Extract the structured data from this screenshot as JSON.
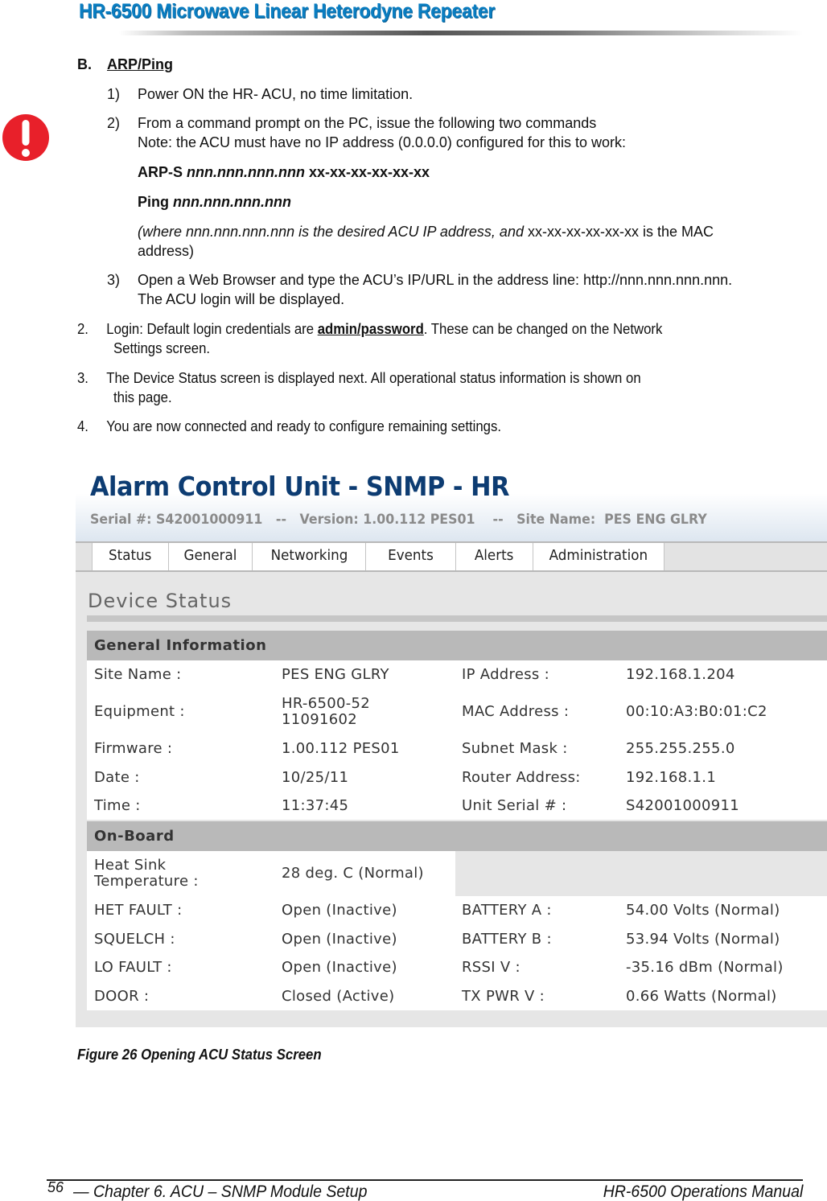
{
  "header": {
    "title": "HR-6500 Microwave Linear Heterodyne Repeater"
  },
  "section": {
    "letter": "B.",
    "title": "ARP/Ping"
  },
  "steps_sub": [
    {
      "num": "1)",
      "text": "Power ON the HR- ACU, no time limitation."
    },
    {
      "num": "2)",
      "line1": "From a command prompt on the PC, issue the following two commands",
      "line2": "Note: the ACU must have no IP address (0.0.0.0) configured for this to work:"
    },
    {
      "num": "3)",
      "line1": "Open a Web Browser and type the ACU’s IP/URL in the address line: http://nnn.nnn.nnn.nnn.",
      "line2": "The ACU login will be displayed."
    }
  ],
  "commands": {
    "arp_cmd": "ARP-S ",
    "arp_ip": "nnn.nnn.nnn.nnn",
    "arp_mac": " xx-xx-xx-xx-xx-xx",
    "ping_cmd": "Ping ",
    "ping_ip": "nnn.nnn.nnn.nnn",
    "note_ital": "(where nnn.nnn.nnn.nnn is the desired ACU IP address, and",
    "note_mac": " xx-xx-xx-xx-xx-xx is the MAC",
    "note_end": "address)"
  },
  "steps_main": [
    {
      "num": "2.",
      "pre": "Login: Default login credentials are ",
      "cred": "admin/password",
      "post": ". These can be changed on the Network",
      "line2": "Settings screen."
    },
    {
      "num": "3.",
      "line1": "The Device Status screen is displayed next. All operational status information is shown on",
      "line2": "this page."
    },
    {
      "num": "4.",
      "line1": "You are now connected and ready to configure remaining settings."
    }
  ],
  "acu": {
    "title": "Alarm Control Unit - SNMP - HR",
    "subtitle": "Serial #: S42001000911   --   Version: 1.00.112 PES01    --   Site Name:  PES ENG GLRY",
    "tabs": [
      "Status",
      "General",
      "Networking",
      "Events",
      "Alerts",
      "Administration"
    ],
    "page_title": "Device Status",
    "general": {
      "heading": "General Information",
      "rows": [
        [
          "Site Name :",
          "PES ENG GLRY",
          "IP Address :",
          "192.168.1.204"
        ],
        [
          "Equipment :",
          "HR-6500-52\n11091602",
          "MAC Address :",
          "00:10:A3:B0:01:C2"
        ],
        [
          "Firmware :",
          "1.00.112 PES01",
          "Subnet Mask :",
          "255.255.255.0"
        ],
        [
          "Date :",
          "10/25/11",
          "Router Address:",
          "192.168.1.1"
        ],
        [
          "Time :",
          "11:37:45",
          "Unit Serial # :",
          "S42001000911"
        ]
      ]
    },
    "onboard": {
      "heading": "On-Board",
      "heat_label": "Heat Sink\nTemperature :",
      "heat_value": "28 deg. C (Normal)",
      "rows": [
        [
          "HET FAULT :",
          "Open (Inactive)",
          "BATTERY A :",
          "54.00 Volts (Normal)"
        ],
        [
          "SQUELCH :",
          "Open (Inactive)",
          "BATTERY B :",
          "53.94 Volts (Normal)"
        ],
        [
          "LO FAULT :",
          "Open (Inactive)",
          "RSSI V :",
          "-35.16 dBm (Normal)"
        ],
        [
          "DOOR :",
          "Closed (Active)",
          "TX PWR V :",
          "0.66 Watts (Normal)"
        ]
      ]
    }
  },
  "caption": "Figure 26  Opening ACU Status Screen",
  "footer": {
    "page": "56",
    "left": "— Chapter 6. ACU – SNMP Module Setup",
    "right": "HR-6500 Operations Manual"
  },
  "colors": {
    "header_blue": "#0a7ec2",
    "acu_title": "#0d3c72",
    "alert_red": "#e8202a"
  }
}
